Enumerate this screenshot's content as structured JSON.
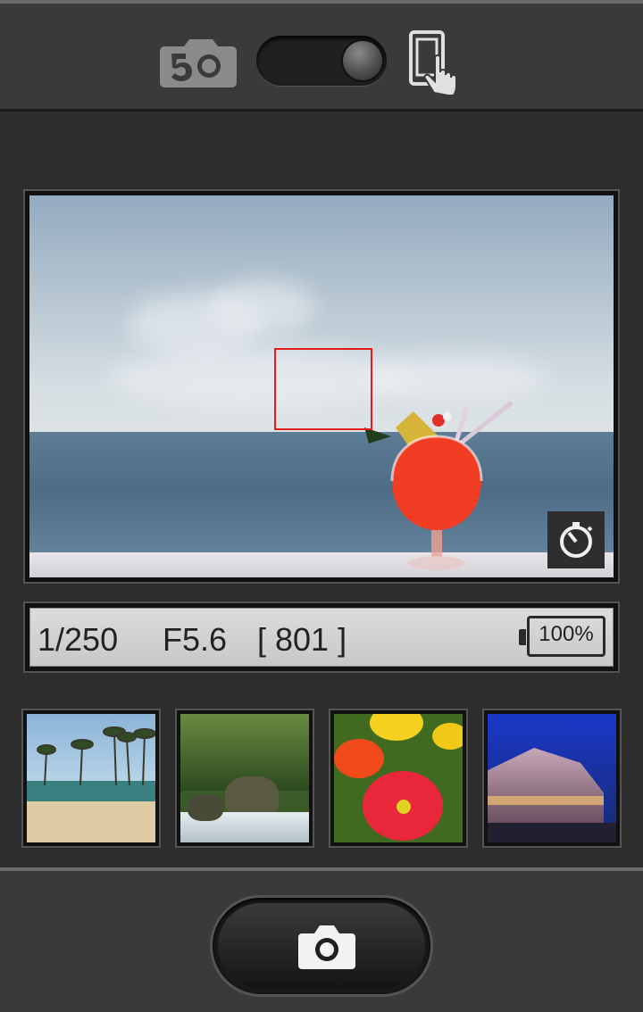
{
  "header": {
    "mode_icon": "photo-mode-camera-icon",
    "toggle_state": "on",
    "touch_icon": "touch-shutter-icon"
  },
  "viewfinder": {
    "focus_frame_color": "#e21b1b",
    "timer_icon": "self-timer-icon"
  },
  "info": {
    "shutter_speed": "1/250",
    "aperture": "F5.6",
    "shots_remaining": "[ 801 ]",
    "battery": "100%"
  },
  "thumbnails": [
    {
      "subject": "beach-palm-trees"
    },
    {
      "subject": "forest-waterfall"
    },
    {
      "subject": "red-poppy-flowers"
    },
    {
      "subject": "building-at-night"
    }
  ],
  "footer": {
    "shutter_icon": "camera-shutter-icon"
  }
}
